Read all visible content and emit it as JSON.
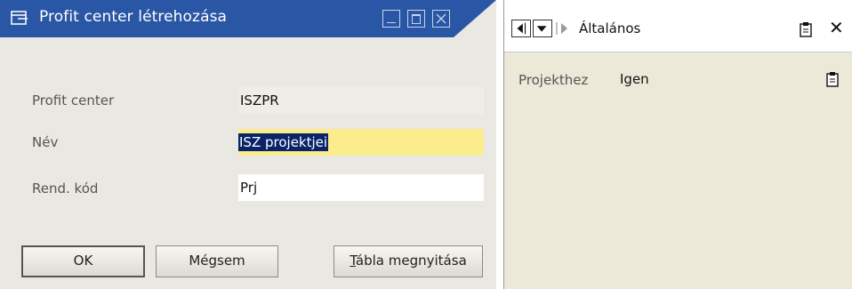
{
  "window": {
    "title": "Profit center létrehozása",
    "title_color": "#2a56a6",
    "controls": {
      "minimize": "minimize-icon",
      "maximize": "maximize-icon",
      "close": "close-icon"
    }
  },
  "form": {
    "fields": [
      {
        "label": "Profit center",
        "value": "ISZPR"
      },
      {
        "label": "Név",
        "value": "ISZ projektjei"
      },
      {
        "label": "Rend. kód",
        "value": "Prj"
      }
    ],
    "name_field_bg": "#fbec8d"
  },
  "buttons": {
    "ok": "OK",
    "cancel": "Mégsem",
    "table_prefix": "T",
    "table_rest": "ábla megnyitása"
  },
  "side_panel": {
    "category": "Általános",
    "property_label": "Projekthez",
    "property_value": "Igen"
  }
}
